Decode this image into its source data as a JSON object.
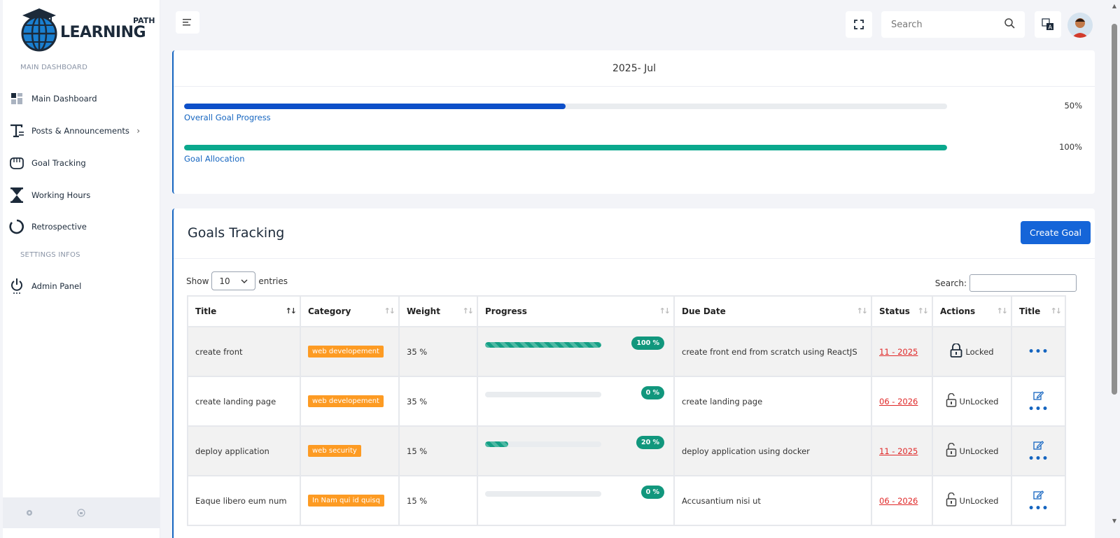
{
  "brand": {
    "path": "PATH",
    "learning": "LEARNING"
  },
  "sidebar": {
    "section_main": "MAIN DASHBOARD",
    "section_settings": "SETTINGS INFOS",
    "items": [
      {
        "label": "Main Dashboard",
        "icon": "dashboard-icon"
      },
      {
        "label": "Posts & Announcements",
        "icon": "text-icon"
      },
      {
        "label": "Goal Tracking",
        "icon": "hand-icon"
      },
      {
        "label": "Working Hours",
        "icon": "hourglass-icon"
      },
      {
        "label": "Retrospective",
        "icon": "circle-icon"
      },
      {
        "label": "Admin Panel",
        "icon": "power-icon"
      }
    ]
  },
  "topbar": {
    "search_placeholder": "Search"
  },
  "period": {
    "title": "2025- Jul",
    "overall_label": "Overall Goal Progress",
    "overall_value": "50%",
    "overall_fraction": 0.5,
    "overall_color": "#0d4fc9",
    "allocation_label": "Goal Allocation",
    "allocation_value": "100%",
    "allocation_fraction": 1.0,
    "allocation_color": "#0aa88d"
  },
  "goals": {
    "title": "Goals Tracking",
    "create_label": "Create Goal",
    "show_label": "Show",
    "entries_value": "10",
    "entries_label": "entries",
    "search_label": "Search:",
    "columns": [
      "Title",
      "Category",
      "Weight",
      "Progress",
      "Due Date",
      "Status",
      "Actions",
      "Title"
    ],
    "rows": [
      {
        "title": "create front",
        "category": "web developement",
        "weight": "35 %",
        "progress": 100,
        "progress_label": "100 %",
        "due": "create front end from scratch using ReactJS",
        "status": "11 - 2025",
        "lock": "Locked",
        "editable": false
      },
      {
        "title": "create landing page",
        "category": "web developement",
        "weight": "35 %",
        "progress": 0,
        "progress_label": "0 %",
        "due": "create landing page",
        "status": "06 - 2026",
        "lock": "UnLocked",
        "editable": true
      },
      {
        "title": "deploy application",
        "category": "web security",
        "weight": "15 %",
        "progress": 20,
        "progress_label": "20 %",
        "due": "deploy application using docker",
        "status": "11 - 2025",
        "lock": "UnLocked",
        "editable": true
      },
      {
        "title": "Eaque libero eum num",
        "category": "In Nam qui id quisq",
        "weight": "15 %",
        "progress": 0,
        "progress_label": "0 %",
        "due": "Accusantium nisi ut",
        "status": "06 - 2026",
        "lock": "UnLocked",
        "editable": true
      }
    ]
  }
}
